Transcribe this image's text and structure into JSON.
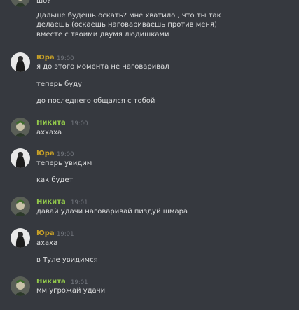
{
  "colors": {
    "background": "#36393f",
    "text": "#dcddde",
    "timestamp": "#72767d",
    "yura_name": "#c9a227",
    "nikita_name": "#92c84b"
  },
  "top_partial": {
    "line0": "шо?",
    "lines": [
      "Дальше будешь оскать? мне хватило , что ты так",
      "делаешь (оскаешь наговариваешь против меня)",
      "вместе с твоими двумя людишками"
    ]
  },
  "groups": [
    {
      "author": "Юра",
      "time": "19:00",
      "avatar_icon": "user-avatar-dark-icon",
      "messages": [
        "я до этого момента не наговаривал",
        "теперь буду",
        "до последнего общался с тобой"
      ]
    },
    {
      "author": "Никита",
      "time": "19:00",
      "avatar_icon": "user-avatar-joker-icon",
      "messages": [
        "аххаха"
      ]
    },
    {
      "author": "Юра",
      "time": "19:00",
      "avatar_icon": "user-avatar-dark-icon",
      "messages": [
        "теперь увидим",
        "как будет"
      ]
    },
    {
      "author": "Никита",
      "time": "19:01",
      "avatar_icon": "user-avatar-joker-icon",
      "messages": [
        "давай удачи наговаривай пиздуй шмара"
      ]
    },
    {
      "author": "Юра",
      "time": "19:01",
      "avatar_icon": "user-avatar-dark-icon",
      "messages": [
        "ахаха",
        "в Туле увидимся"
      ]
    },
    {
      "author": "Никита",
      "time": "19:01",
      "avatar_icon": "user-avatar-joker-icon",
      "messages": [
        "мм угрожай удачи"
      ]
    }
  ]
}
